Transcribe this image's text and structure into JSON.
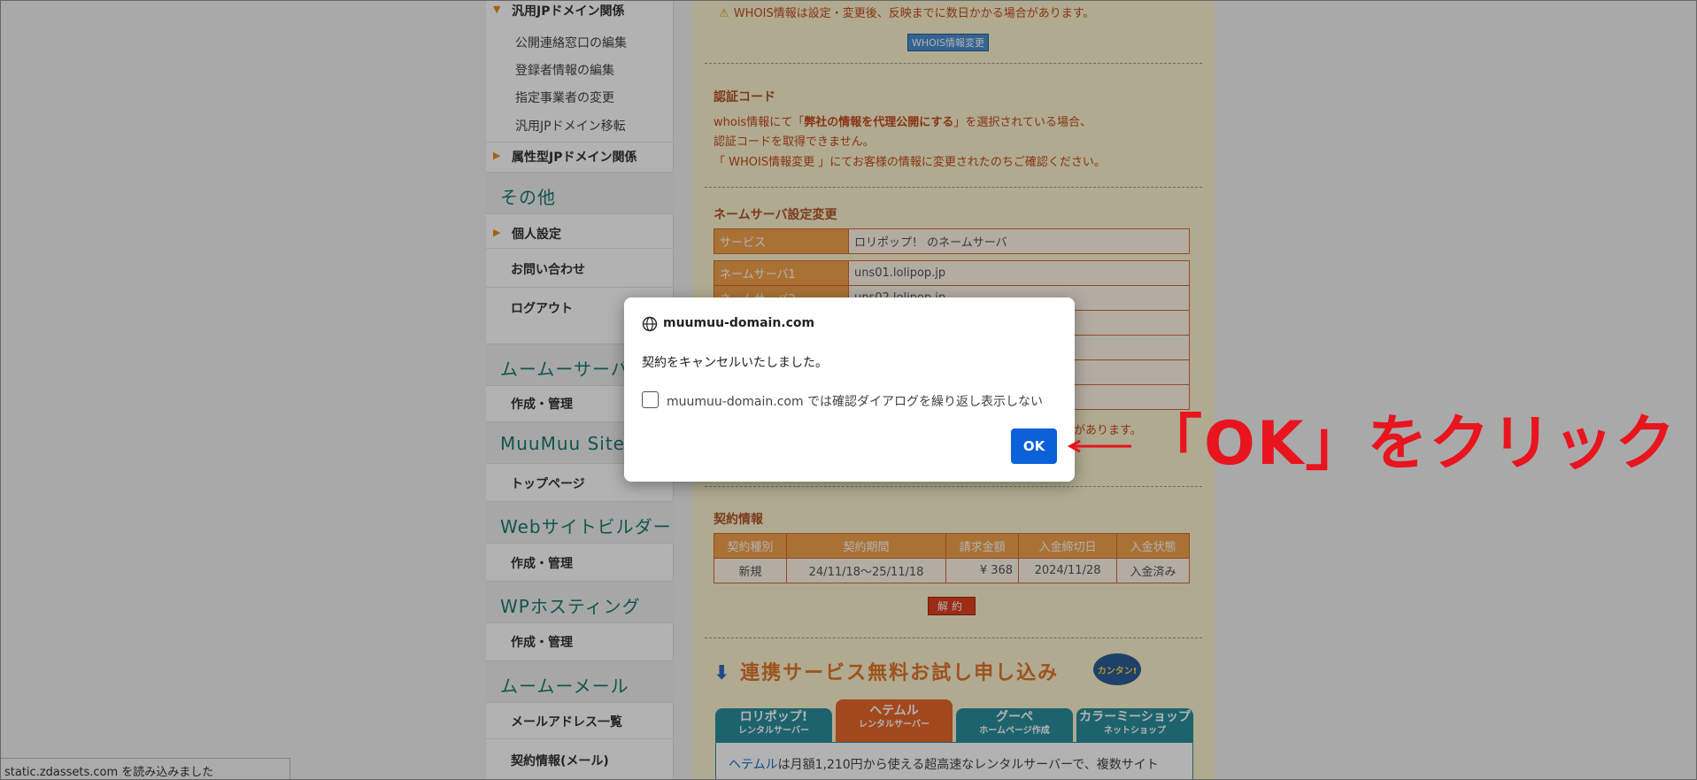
{
  "sidebar": {
    "jp_head": "汎用JPドメイン関係",
    "jp_items": [
      "公開連絡窓口の編集",
      "登録者情報の編集",
      "指定事業者の変更",
      "汎用JPドメイン移転"
    ],
    "attr_head": "属性型JPドメイン関係",
    "other_cat": "その他",
    "personal": "個人設定",
    "contact": "お問い合わせ",
    "logout": "ログアウト",
    "cat_server": "ムームーサーバー",
    "server_item": "作成・管理",
    "cat_sites": "MuuMuu Sites",
    "sites_item": "トップページ",
    "cat_builder": "Webサイトビルダー",
    "builder_item": "作成・管理",
    "cat_wp": "WPホスティング",
    "wp_item": "作成・管理",
    "cat_mail": "ムームーメール",
    "mail_item1": "メールアドレス一覧",
    "mail_item2": "契約情報(メール)"
  },
  "main": {
    "whois_warn": "WHOIS情報は設定・変更後、反映までに数日かかる場合があります。",
    "whois_button": "WHOIS情報変更",
    "auth_title": "認証コード",
    "auth_line1_pre": "whois情報にて「",
    "auth_line1_bold": "弊社の情報を代理公開にする",
    "auth_line1_post": "」を選択されている場合、",
    "auth_line2": "認証コードを取得できません。",
    "auth_line3": "「 WHOIS情報変更 」にてお客様の情報に変更されたのちご確認ください。",
    "ns_title": "ネームサーバ設定変更",
    "service_label": "サービス",
    "service_value": "ロリポップ！ のネームサーバ",
    "ns_rows": [
      {
        "label": "ネームサーバ1",
        "value": "uns01.lolipop.jp"
      },
      {
        "label": "ネームサーバ2",
        "value": "uns02.lolipop.jp"
      },
      {
        "label": "",
        "value": ""
      },
      {
        "label": "",
        "value": ""
      },
      {
        "label": "",
        "value": ""
      },
      {
        "label": "",
        "value": ""
      }
    ],
    "ns_note_tail": "があります。",
    "contract_title": "契約情報",
    "contract_headers": [
      "契約種別",
      "契約期間",
      "請求金額",
      "入金締切日",
      "入金状態"
    ],
    "contract_row": [
      "新規",
      "24/11/18～25/11/18",
      "¥ 368",
      "2024/11/28",
      "入金済み"
    ],
    "cancel_button": "解約",
    "promo_title": "連携サービス無料お試し申し込み",
    "promo_badge": "カンタン!",
    "promo_tabs": [
      {
        "name": "ロリポップ!",
        "sub": "レンタルサーバー"
      },
      {
        "name": "ヘテムル",
        "sub": "レンタルサーバー"
      },
      {
        "name": "グーペ",
        "sub": "ホームページ作成"
      },
      {
        "name": "カラーミーショップ",
        "sub": "ネットショップ"
      }
    ],
    "promo_link": "ヘテムル",
    "promo_text": "は月額1,210円から使える超高速なレンタルサーバーで、複数サイト"
  },
  "status_bar": "static.zdassets.com を読み込みました",
  "dialog": {
    "origin": "muumuu-domain.com",
    "message": "契約をキャンセルいたしました。",
    "checkbox_label": "muumuu-domain.com では確認ダイアログを繰り返し表示しない",
    "checkbox_checked": false,
    "ok_label": "OK"
  },
  "annotation": {
    "text": "「OK」をクリック",
    "color": "#e8141e"
  },
  "colors": {
    "accent_orange": "#f4a24c",
    "dialog_button": "#0b61d8",
    "sidebar_category": "#1b7a72"
  }
}
